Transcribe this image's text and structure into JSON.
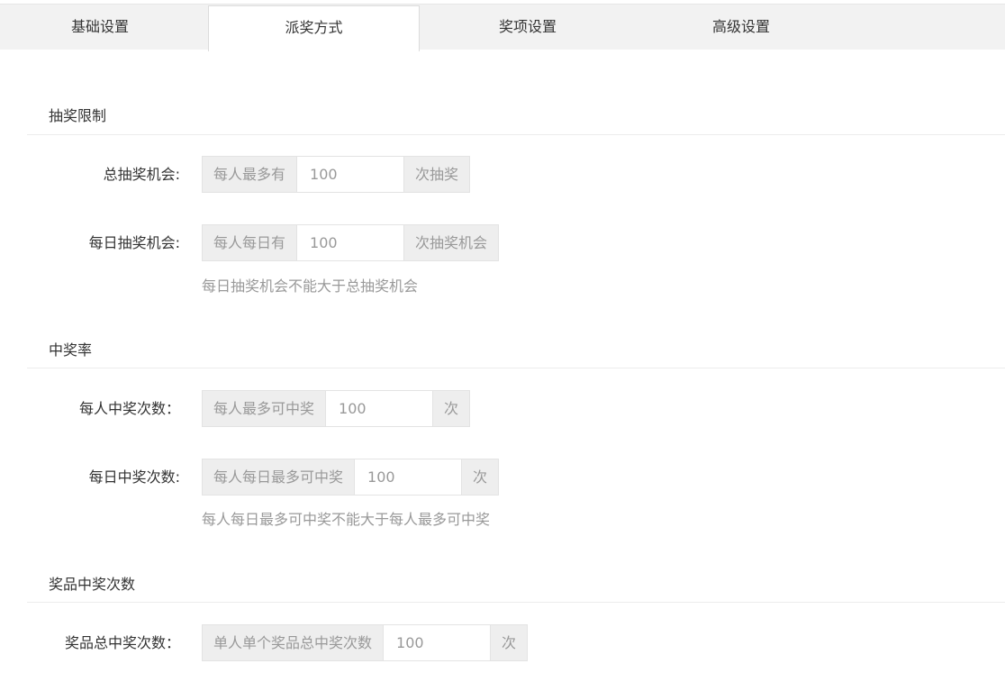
{
  "tabs": [
    {
      "label": "基础设置"
    },
    {
      "label": "派奖方式"
    },
    {
      "label": "奖项设置"
    },
    {
      "label": "高级设置"
    }
  ],
  "sections": {
    "draw_limit": {
      "title": "抽奖限制",
      "total": {
        "label": "总抽奖机会:",
        "prefix": "每人最多有",
        "value": "100",
        "suffix": "次抽奖"
      },
      "daily": {
        "label": "每日抽奖机会:",
        "prefix": "每人每日有",
        "value": "100",
        "suffix": "次抽奖机会",
        "hint": "每日抽奖机会不能大于总抽奖机会"
      }
    },
    "win_rate": {
      "title": "中奖率",
      "per_person": {
        "label": "每人中奖次数：",
        "prefix": "每人最多可中奖",
        "value": "100",
        "suffix": "次"
      },
      "daily": {
        "label": "每日中奖次数:",
        "prefix": "每人每日最多可中奖",
        "value": "100",
        "suffix": "次",
        "hint": "每人每日最多可中奖不能大于每人最多可中奖"
      }
    },
    "prize_count": {
      "title": "奖品中奖次数",
      "total": {
        "label": "奖品总中奖次数：",
        "prefix": "单人单个奖品总中奖次数",
        "value": "100",
        "suffix": "次"
      }
    }
  }
}
